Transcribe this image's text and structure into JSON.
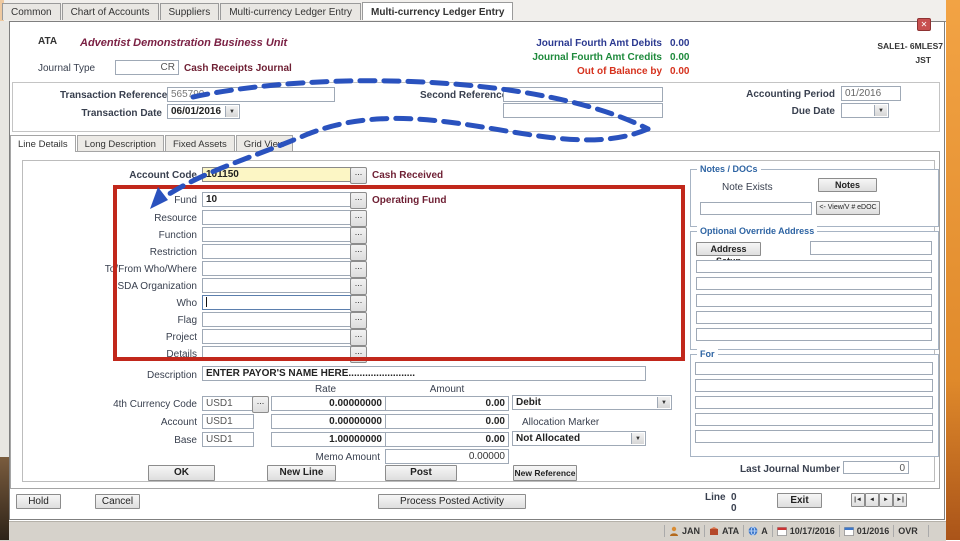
{
  "window": {
    "close_glyph": "✕",
    "ref1": "SALE1- 6MLES7",
    "ref2": "JST"
  },
  "tabs": {
    "items": [
      "Common",
      "Chart of Accounts",
      "Suppliers",
      "Multi-currency Ledger Entry",
      "Multi-currency Ledger Entry"
    ]
  },
  "header": {
    "org_code": "ATA",
    "org_name": "Adventist Demonstration Business Unit",
    "debits_label": "Journal Fourth Amt Debits",
    "debits_value": "0.00",
    "credits_label": "Journal Fourth Amt Credits",
    "credits_value": "0.00",
    "oob_label": "Out of Balance by",
    "oob_value": "0.00",
    "journal_type_label": "Journal Type",
    "journal_type_value": "CR",
    "journal_type_desc": "Cash Receipts Journal"
  },
  "refpanel": {
    "txn_ref_label": "Transaction Reference",
    "txn_ref_value": "565790",
    "txn_date_label": "Transaction Date",
    "txn_date_value": "06/01/2016",
    "second_ref_label": "Second Reference",
    "second_ref_value": "",
    "acct_period_label": "Accounting Period",
    "acct_period_value": "01/2016",
    "due_date_label": "Due Date",
    "due_date_value": "",
    "dropdown_glyph": "▼"
  },
  "subtabs": {
    "items": [
      "Line Details",
      "Long Description",
      "Fixed Assets",
      "Grid View"
    ]
  },
  "form": {
    "ellipsis": "...",
    "account_code_label": "Account Code",
    "account_code_value": "101150",
    "account_code_desc": "Cash Received",
    "fund_label": "Fund",
    "fund_value": "10",
    "fund_desc": "Operating Fund",
    "analysis_labels": [
      "Resource",
      "Function",
      "Restriction",
      "To/From   Who/Where",
      "SDA Organization",
      "Who",
      "Flag",
      "Project",
      "Details"
    ],
    "description_label": "Description",
    "description_value": "ENTER PAYOR'S NAME HERE........................"
  },
  "currency": {
    "rate_header": "Rate",
    "amount_header": "Amount",
    "c4_label": "4th Currency Code",
    "c4_code": "USD1",
    "c4_rate": "0.00000000",
    "c4_amount": "0.00",
    "c4_drcr": "Debit",
    "acct_label": "Account",
    "acct_code": "USD1",
    "acct_rate": "0.00000000",
    "acct_amount": "0.00",
    "alloc_label": "Allocation Marker",
    "base_label": "Base",
    "base_code": "USD1",
    "base_rate": "1.00000000",
    "base_amount": "0.00",
    "alloc_value": "Not Allocated",
    "memo_label": "Memo Amount",
    "memo_value": "0.00000"
  },
  "actions": {
    "ok": "OK",
    "new_line": "New Line",
    "post": "Post",
    "new_ref": "New Reference"
  },
  "notes": {
    "title": "Notes / DOCs",
    "note_exists": "Note Exists",
    "notes_btn": "Notes",
    "edoc_btn": "<- View/V # eDOC"
  },
  "address": {
    "title": "Optional Override Address",
    "setup_btn": "Address Setup"
  },
  "forpanel": {
    "title": "For"
  },
  "last_journal": {
    "label": "Last Journal Number",
    "value": "0"
  },
  "footer": {
    "hold": "Hold",
    "cancel": "Cancel",
    "process": "Process Posted Activity",
    "line_label": "Line",
    "line_value": "0",
    "line_value2": "0",
    "exit": "Exit",
    "nav0": "|◄",
    "nav1": "◄",
    "nav2": "►",
    "nav3": "►|"
  },
  "statusbar": {
    "user": "JAN",
    "unit": "ATA",
    "ledger": "A",
    "date": "10/17/2016",
    "period": "01/2016",
    "ovr": "OVR"
  },
  "colors": {
    "highlight_box": "#c1271b",
    "arrow": "#2a52be",
    "field_highlight": "#fcf6c5"
  }
}
